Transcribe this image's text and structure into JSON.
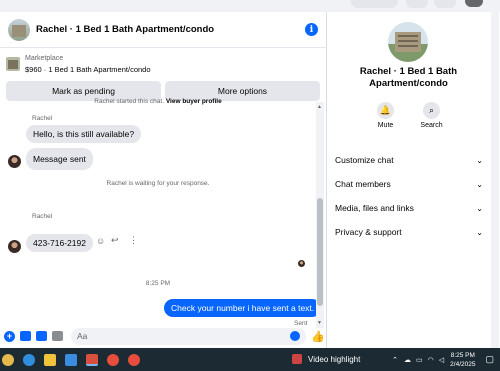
{
  "header": {
    "title": "Rachel · 1 Bed 1 Bath Apartment/condo"
  },
  "listing": {
    "label": "Marketplace",
    "subtitle": "$960 · 1 Bed 1 Bath Apartment/condo"
  },
  "actions": {
    "mark_pending": "Mark as pending",
    "more_options": "More options"
  },
  "conversation": {
    "started_text": "Rachel started this chat.",
    "view_buyer_profile": "View buyer profile",
    "messages": [
      {
        "sender": "Rachel",
        "text": "Hello, is this still available?"
      },
      {
        "sender": "",
        "text": "Message sent"
      },
      {
        "status": "Rachel is waiting for your response."
      },
      {
        "sender": "Rachel",
        "text": "423-716-2192"
      },
      {
        "time": "8:25 PM"
      },
      {
        "outgoing": true,
        "text": "Check your number i have sent a text.",
        "status": "Sent"
      }
    ]
  },
  "composer": {
    "placeholder": "Aa"
  },
  "right_panel": {
    "title": "Rachel · 1 Bed 1 Bath Apartment/condo",
    "mute_label": "Mute",
    "search_label": "Search",
    "menu": [
      "Customize chat",
      "Chat members",
      "Media, files and links",
      "Privacy & support"
    ]
  },
  "taskbar": {
    "video_highlight": "Video highlight",
    "time": "8:25 PM",
    "date": "2/4/2025"
  },
  "colors": {
    "accent": "#0866ff",
    "bubble_incoming": "#e4e6eb",
    "taskbar": "#1c2b33"
  }
}
